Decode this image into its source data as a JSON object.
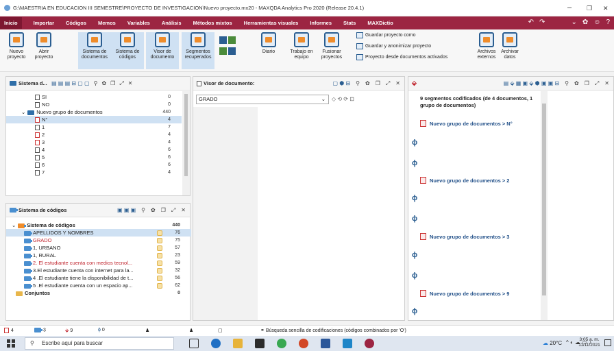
{
  "window": {
    "title": "G:\\MAESTRIA EN EDUCACION III SEMESTRE\\PROYECTO DE INVESTIGACION\\Nuevo proyecto.mx20 - MAXQDA Analytics Pro 2020 (Release 20.4.1)",
    "minimize": "–",
    "restore": "❐",
    "close": "✕"
  },
  "menu": [
    "Inicio",
    "Importar",
    "Códigos",
    "Memos",
    "Variables",
    "Análisis",
    "Métodos mixtos",
    "Herramientas visuales",
    "Informes",
    "Stats",
    "MAXDictio"
  ],
  "menu_icons": [
    "↶",
    "↷",
    "⌄",
    "✿",
    "☺",
    "?"
  ],
  "ribbon": {
    "nuevo_proyecto": [
      "Nuevo",
      "proyecto"
    ],
    "abrir_proyecto": [
      "Abrir",
      "proyecto"
    ],
    "sistema_documentos": [
      "Sistema de",
      "documentos"
    ],
    "sistema_codigos": [
      "Sistema de",
      "códigos"
    ],
    "visor_documento": [
      "Visor de",
      "documento"
    ],
    "segmentos_recuperados": [
      "Segmentos",
      "recuperados"
    ],
    "diario": "Diario",
    "trabajo_equipo": [
      "Trabajo en",
      "equipo"
    ],
    "fusionar_proyectos": [
      "Fusionar",
      "proyectos"
    ],
    "guardar_como": "Guardar proyecto como",
    "guardar_anonimizar": "Guardar y anonimizar proyecto",
    "proyecto_desde_docs": "Proyecto desde documentos activados",
    "archivos_externos": [
      "Archivos",
      "externos"
    ],
    "archivar_datos": [
      "Archivar",
      "datos"
    ]
  },
  "doc_system": {
    "title": "Sistema d...",
    "rows": [
      {
        "label": "SI",
        "count": "0"
      },
      {
        "label": "NO",
        "count": "0"
      },
      {
        "label": "Nuevo grupo de documentos",
        "count": "440"
      },
      {
        "label": "N°",
        "count": "4"
      },
      {
        "label": "1",
        "count": "7"
      },
      {
        "label": "2",
        "count": "4"
      },
      {
        "label": "3",
        "count": "4"
      },
      {
        "label": "4",
        "count": "6"
      },
      {
        "label": "5",
        "count": "6"
      },
      {
        "label": "6",
        "count": "6"
      },
      {
        "label": "7",
        "count": "4"
      }
    ]
  },
  "code_system": {
    "title": "Sistema de códigos",
    "root": {
      "label": "Sistema de códigos",
      "count": "440"
    },
    "rows": [
      {
        "label": "APELLIDOS Y NOMBRES",
        "count": "76"
      },
      {
        "label": "GRADO",
        "count": "75"
      },
      {
        "label": "1,  URBANO",
        "count": "57"
      },
      {
        "label": "1, RURAL",
        "count": "23"
      },
      {
        "label": "2. El estudiante cuenta con medios tecnol...",
        "count": "59"
      },
      {
        "label": "3.El estudiante cuenta con internet para la...",
        "count": "32"
      },
      {
        "label": "4 .El estudiante tiene la disponibilidad de t...",
        "count": "56"
      },
      {
        "label": "5 .El estudiante cuenta con un espacio  ap...",
        "count": "62"
      }
    ],
    "conjuntos": {
      "label": "Conjuntos",
      "count": "0"
    }
  },
  "doc_viewer": {
    "title": "Visor de documento:",
    "field": "GRADO"
  },
  "retrieved": {
    "summary": "9 segmentos codificados (de 4 documentos, 1 grupo de documentos)",
    "groups": [
      "Nuevo grupo de documentos > N°",
      "Nuevo grupo de documentos > 2",
      "Nuevo grupo de documentos > 3",
      "Nuevo grupo de documentos > 9"
    ]
  },
  "statusbar": {
    "docs": "4",
    "codes": "3",
    "segments": "9",
    "memos": "0",
    "search": "Búsqueda sencilla de codificaciones (códigos combinados por 'O')"
  },
  "taskbar": {
    "search_placeholder": "Escribe aquí para buscar",
    "weather": "20°C",
    "time": "3:05 a. m.",
    "date": "11/11/2021"
  },
  "colors": {
    "menubar": "#9c2542",
    "accent_blue": "#2b5e91",
    "code_color": "#f7e1a6",
    "segment_red": "#c0242d"
  }
}
